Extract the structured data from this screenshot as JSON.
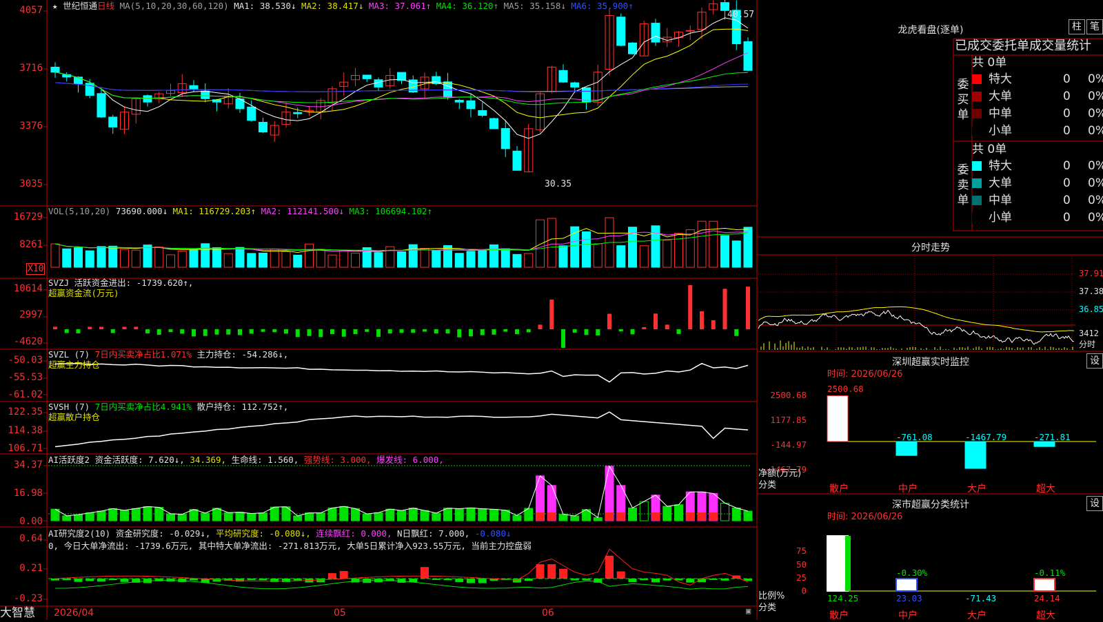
{
  "stock": {
    "star": "★",
    "name": "世纪恒通",
    "period": "日线"
  },
  "main": {
    "ma_label": "MA(5,10,20,30,60,120)",
    "ma1": "MA1: 38.530↓",
    "ma2": "MA2: 38.417↓",
    "ma3": "MA3: 37.061↑",
    "ma4": "MA4: 36.120↑",
    "ma5": "MA5: 35.158↓",
    "ma6": "MA6: 35.900↑",
    "ticks": [
      "4057",
      "3716",
      "3376",
      "3035"
    ],
    "high_label": "40.57",
    "low_label": "30.35"
  },
  "vol": {
    "hdr": "VOL(5,10,20)",
    "val": "73690.000↓",
    "ma1": "MA1: 116729.203↑",
    "ma2": "MA2: 112141.500↓",
    "ma3": "MA3: 106694.102↑",
    "ticks": [
      "16729",
      "8261"
    ],
    "unit": "X10"
  },
  "svzj": {
    "hdr": "SVZJ  活跃资金进出: -1739.620↑,",
    "sub": "超赢资金流(万元)",
    "ticks": [
      "10614",
      "2997",
      "-4620"
    ]
  },
  "svzl": {
    "hdr": "SVZL (7)",
    "pct": "7日内买卖净占比1.071%",
    "hold": "主力持仓: -54.286↓,",
    "sub": "超赢主力持仓",
    "ticks": [
      "-50.03",
      "-55.53",
      "-61.02"
    ]
  },
  "svsh": {
    "hdr": "SVSH (7)",
    "pct": "7日内买卖净占比4.941%",
    "hold": "散户持仓: 112.752↑,",
    "sub": "超赢散户持仓",
    "ticks": [
      "122.35",
      "114.38",
      "106.71"
    ]
  },
  "ai1": {
    "hdr": "AI活跃度2 资金活跃度: 7.620↓,",
    "v2": "34.369,",
    "life": "生命线: 1.560,",
    "strong": "强势线: 3.000,",
    "burst": "爆发线: 6.000,",
    "ticks": [
      "34.37",
      "16.98",
      "0.00"
    ]
  },
  "ai2": {
    "hdr": "AI研究度2(10) 资金研究度: -0.029↓,",
    "avg": "平均研究度: -0.080↓,",
    "red": "连续飘红: 0.000,",
    "nred": "N日飘红: 7.000,",
    "last": "-0.080↓",
    "line2": "0, 今日大单净流出: -1739.6万元, 其中特大单净流出: -271.813万元, 大单5日累计净入923.55万元, 当前主力控盘弱",
    "ticks": [
      "0.64",
      "0.21",
      "-0.23"
    ]
  },
  "dates": {
    "d1": "2026/04",
    "d2": "05",
    "d3": "06"
  },
  "brand": "大智慧",
  "dragon": {
    "title": "龙虎看盘(逐单)",
    "btn1": "柱",
    "btn2": "笔",
    "tabs": "已成交委托单成交量统计",
    "buy_side": "委买单",
    "sell_side": "委卖单",
    "buy_total": "共 0单",
    "sell_total": "共 0单",
    "buy": [
      {
        "label": "特大",
        "qty": "0",
        "pct": "0%",
        "color": "#ff0000"
      },
      {
        "label": "大单",
        "qty": "0",
        "pct": "0%",
        "color": "#a00000"
      },
      {
        "label": "中单",
        "qty": "0",
        "pct": "0%",
        "color": "#700000"
      },
      {
        "label": "小单",
        "qty": "0",
        "pct": "0%",
        "color": "#000000"
      }
    ],
    "sell": [
      {
        "label": "特大",
        "qty": "0",
        "pct": "0%",
        "color": "#00ffff"
      },
      {
        "label": "大单",
        "qty": "0",
        "pct": "0%",
        "color": "#00a0a0"
      },
      {
        "label": "中单",
        "qty": "0",
        "pct": "0%",
        "color": "#007070"
      },
      {
        "label": "小单",
        "qty": "0",
        "pct": "0%",
        "color": "#000000"
      }
    ]
  },
  "intraday": {
    "title": "分时走势",
    "ticks": [
      "37.91",
      "37.38",
      "36.85"
    ],
    "vol_tick": "3412",
    "vol_label": "分时"
  },
  "monitor": {
    "title": "深圳超赢实时监控",
    "btn": "设",
    "time": "时间: 2026/06/26",
    "top": "2500.68",
    "ticks": [
      "2500.68",
      "1177.85",
      "-144.97",
      "-1467.79"
    ],
    "ylabel": "净额(万元)",
    "xlabel": "分类",
    "vals": [
      "-761.08",
      "-1467.79",
      "-271.81"
    ],
    "cats": [
      "散户",
      "中户",
      "大户",
      "超大"
    ]
  },
  "classify": {
    "title": "深市超赢分类统计",
    "btn": "设",
    "time": "时间: 2026/06/26",
    "ticks": [
      "75",
      "50",
      "25",
      "0"
    ],
    "ylabel": "比例%",
    "xlabel": "分类",
    "pcts": [
      "-0.30%",
      "-0.11%"
    ],
    "vals": [
      "124.25",
      "23.03",
      "-71.43",
      "24.14"
    ],
    "cats": [
      "散户",
      "中户",
      "大户",
      "超大"
    ]
  },
  "colors": {
    "up": "#ff3030",
    "down": "#00ffff",
    "grid": "#c00000",
    "ma1": "#ffffff",
    "ma2": "#ffff00",
    "ma3": "#ff40ff",
    "ma4": "#00ff00",
    "ma5": "#b0b0b0",
    "ma6": "#3030ff"
  }
}
